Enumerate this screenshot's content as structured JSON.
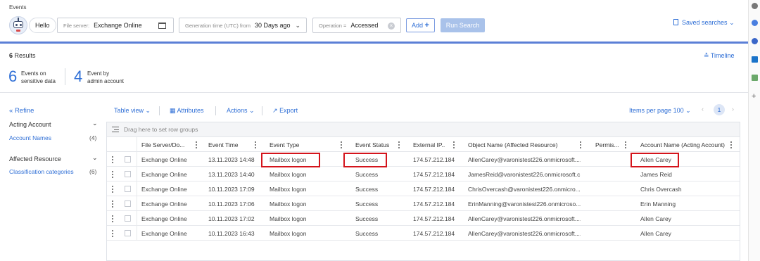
{
  "header": {
    "section": "Events",
    "greeting": "Hello",
    "filters": [
      {
        "label": "File server:",
        "value": "Exchange Online"
      },
      {
        "label": "Generation time (UTC) from",
        "value": "30 Days ago"
      },
      {
        "label": "Operation =",
        "value": "Accessed"
      }
    ],
    "add_label": "Add",
    "run_label": "Run Search",
    "saved_label": "Saved searches"
  },
  "summary": {
    "results_count": "6",
    "results_label": "Results",
    "timeline_label": "Timeline",
    "stats": [
      {
        "value": "6",
        "label_line1": "Events on",
        "label_line2": "sensitive data"
      },
      {
        "value": "4",
        "label_line1": "Event by",
        "label_line2": "admin account"
      }
    ]
  },
  "sidebar": {
    "refine_label": "Refine",
    "sections": [
      {
        "title": "Acting Account",
        "item": "Account Names",
        "count": "(4)"
      },
      {
        "title": "Affected Resource",
        "item": "Classification categories",
        "count": "(6)"
      }
    ]
  },
  "toolbar": {
    "table_view": "Table view",
    "attributes": "Attributes",
    "actions": "Actions",
    "export": "Export",
    "items_per_page_label": "Items per page",
    "items_per_page_value": "100",
    "current_page": "1"
  },
  "grid": {
    "group_hint": "Drag here to set row groups",
    "columns": [
      "File Server/Do...",
      "Event Time",
      "Event Type",
      "Event Status",
      "External IP...",
      "Object Name (Affected Resource)",
      "Permis...",
      "Account Name (Acting Account)"
    ],
    "rows": [
      [
        "Exchange Online",
        "13.11.2023 14:48",
        "Mailbox logon",
        "Success",
        "174.57.212.184",
        "AllenCarey@varonistest226.onmicrosoft....",
        "",
        "Allen Carey"
      ],
      [
        "Exchange Online",
        "13.11.2023 14:40",
        "Mailbox logon",
        "Success",
        "174.57.212.184",
        "JamesReid@varonistest226.onmicrosoft.c...",
        "",
        "James Reid"
      ],
      [
        "Exchange Online",
        "10.11.2023 17:09",
        "Mailbox logon",
        "Success",
        "174.57.212.184",
        "ChrisOvercash@varonistest226.onmicro...",
        "",
        "Chris Overcash"
      ],
      [
        "Exchange Online",
        "10.11.2023 17:06",
        "Mailbox logon",
        "Success",
        "174.57.212.184",
        "ErinManning@varonistest226.onmicroso...",
        "",
        "Erin Manning"
      ],
      [
        "Exchange Online",
        "10.11.2023 17:02",
        "Mailbox logon",
        "Success",
        "174.57.212.184",
        "AllenCarey@varonistest226.onmicrosoft....",
        "",
        "Allen Carey"
      ],
      [
        "Exchange Online",
        "10.11.2023 16:43",
        "Mailbox logon",
        "Success",
        "174.57.212.184",
        "AllenCarey@varonistest226.onmicrosoft....",
        "",
        "Allen Carey"
      ]
    ]
  },
  "colors": {
    "accent": "#2f6fd6",
    "highlight": "#d4141c",
    "run_button": "#a9c2ea"
  }
}
